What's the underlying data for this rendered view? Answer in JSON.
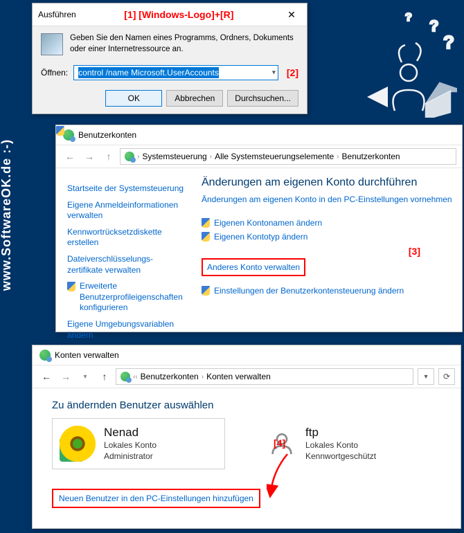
{
  "watermark": "www.SoftwareOK.de :-)",
  "annotations": {
    "a1": "[1]  [Windows-Logo]+[R]",
    "a2": "[2]",
    "a3": "[3]",
    "a4": "[4]"
  },
  "run_dialog": {
    "title": "Ausführen",
    "description": "Geben Sie den Namen eines Programms, Ordners, Dokuments oder einer Internetressource an.",
    "open_label": "Öffnen:",
    "command": "control /name Microsoft.UserAccounts",
    "buttons": {
      "ok": "OK",
      "cancel": "Abbrechen",
      "browse": "Durchsuchen..."
    }
  },
  "window2": {
    "title": "Benutzerkonten",
    "breadcrumbs": [
      "Systemsteuerung",
      "Alle Systemsteuerungselemente",
      "Benutzerkonten"
    ],
    "side_links": {
      "home": "Startseite der Systemsteuerung",
      "creds": "Eigene Anmeldeinformationen verwalten",
      "reset_disk": "Kennwortrücksetzdiskette erstellen",
      "certs": "Dateiverschlüsselungs-\nzertifikate verwalten",
      "profiles": "Erweiterte Benutzerprofileigenschaften konfigurieren",
      "envvars": "Eigene Umgebungsvariablen ändern"
    },
    "main": {
      "heading": "Änderungen am eigenen Konto durchführen",
      "pc_settings": "Änderungen am eigenen Konto in den PC-Einstellungen vornehmen",
      "rename": "Eigenen Kontonamen ändern",
      "type": "Eigenen Kontotyp ändern",
      "manage_other": "Anderes Konto verwalten",
      "uac": "Einstellungen der Benutzerkontensteuerung ändern"
    }
  },
  "window3": {
    "title": "Konten verwalten",
    "breadcrumbs": [
      "Benutzerkonten",
      "Konten verwalten"
    ],
    "heading": "Zu ändernden Benutzer auswählen",
    "accounts": [
      {
        "name": "Nenad",
        "line1": "Lokales Konto",
        "line2": "Administrator"
      },
      {
        "name": "ftp",
        "line1": "Lokales Konto",
        "line2": "Kennwortgeschützt"
      }
    ],
    "add_link": "Neuen Benutzer in den PC-Einstellungen hinzufügen"
  }
}
